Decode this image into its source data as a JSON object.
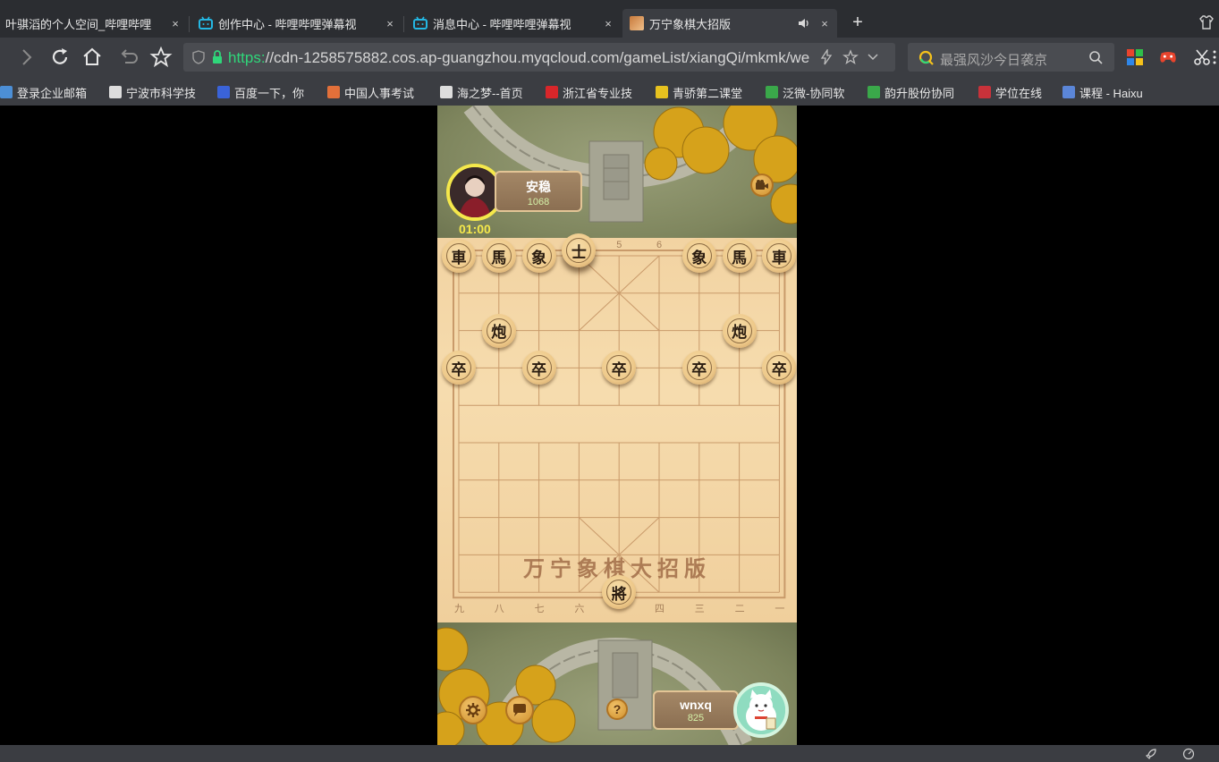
{
  "browser": {
    "tabs": [
      {
        "title": "叶骐滔的个人空间_哔哩哔哩",
        "active": false
      },
      {
        "title": "创作中心 - 哔哩哔哩弹幕视",
        "active": false
      },
      {
        "title": "消息中心 - 哔哩哔哩弹幕视",
        "active": false
      },
      {
        "title": "万宁象棋大招版",
        "active": true
      }
    ],
    "close_glyph": "×",
    "new_tab_glyph": "+",
    "url_scheme": "https:",
    "url_rest": "//cdn-1258575882.cos.ap-guangzhou.myqcloud.com/gameList/xiangQi/mkmk/we",
    "search_placeholder": "最强风沙今日袭京",
    "bookmarks": [
      {
        "label": "登录企业邮箱",
        "color": "#4c8fd6"
      },
      {
        "label": "宁波市科学技",
        "color": "#dddddd"
      },
      {
        "label": "百度一下，你",
        "color": "#3a63d8"
      },
      {
        "label": "中国人事考试",
        "color": "#e2703a"
      },
      {
        "label": "海之梦--首页",
        "color": "#dddddd"
      },
      {
        "label": "浙江省专业技",
        "color": "#d8262a"
      },
      {
        "label": "青骄第二课堂",
        "color": "#e7c21f"
      },
      {
        "label": "泛微-协同软",
        "color": "#3aa84a"
      },
      {
        "label": "韵升股份协同",
        "color": "#3aa84a"
      },
      {
        "label": "学位在线",
        "color": "#c8323a"
      },
      {
        "label": "课程 - Haixu",
        "color": "#5b86d8"
      }
    ]
  },
  "game": {
    "title": "万宁象棋大招版",
    "opponent": {
      "name": "安稳",
      "score": "1068",
      "timer": "01:00"
    },
    "player": {
      "name": "wnxq",
      "score": "825"
    },
    "help_label": "?",
    "top_column_numbers": [
      "5",
      "6"
    ],
    "bottom_column_numbers": [
      "九",
      "八",
      "七",
      "六",
      "四",
      "三",
      "二",
      "一"
    ],
    "pieces": [
      {
        "char": "車",
        "col": 0,
        "row": 0
      },
      {
        "char": "馬",
        "col": 1,
        "row": 0
      },
      {
        "char": "象",
        "col": 2,
        "row": 0
      },
      {
        "char": "士",
        "col": 3,
        "row": 0,
        "lifted": true
      },
      {
        "char": "象",
        "col": 6,
        "row": 0
      },
      {
        "char": "馬",
        "col": 7,
        "row": 0
      },
      {
        "char": "車",
        "col": 8,
        "row": 0
      },
      {
        "char": "炮",
        "col": 1,
        "row": 2
      },
      {
        "char": "炮",
        "col": 7,
        "row": 2
      },
      {
        "char": "卒",
        "col": 0,
        "row": 3
      },
      {
        "char": "卒",
        "col": 2,
        "row": 3
      },
      {
        "char": "卒",
        "col": 4,
        "row": 3
      },
      {
        "char": "卒",
        "col": 6,
        "row": 3
      },
      {
        "char": "卒",
        "col": 8,
        "row": 3
      },
      {
        "char": "將",
        "col": 4,
        "row": 9
      }
    ]
  }
}
